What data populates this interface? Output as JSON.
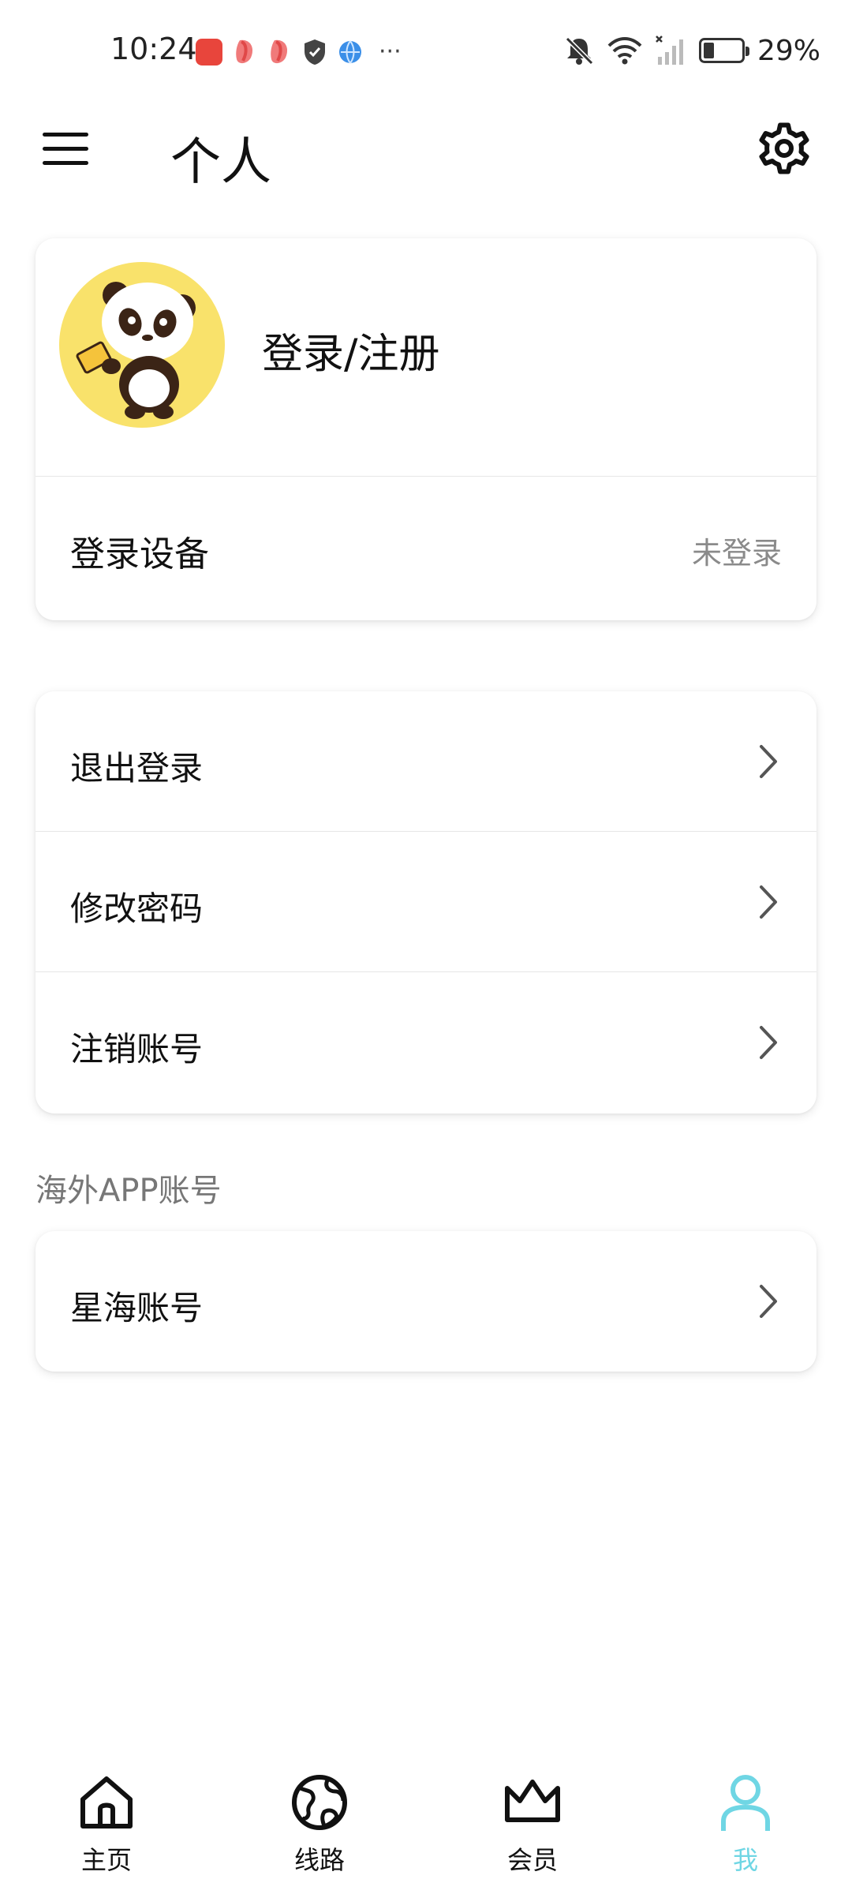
{
  "status_bar": {
    "time": "10:24",
    "battery_percent": "29%",
    "battery_level": 0.29
  },
  "header": {
    "title": "个人",
    "menu_icon": "menu-icon",
    "settings_icon": "gear-icon"
  },
  "profile": {
    "avatar_icon": "panda-avatar",
    "login_label": "登录/注册",
    "device_label": "登录设备",
    "device_status": "未登录"
  },
  "actions": [
    {
      "label": "退出登录"
    },
    {
      "label": "修改密码"
    },
    {
      "label": "注销账号"
    }
  ],
  "overseas": {
    "section_title": "海外APP账号",
    "items": [
      {
        "label": "星海账号"
      }
    ]
  },
  "bottom_nav": {
    "items": [
      {
        "label": "主页",
        "icon": "home-icon"
      },
      {
        "label": "线路",
        "icon": "globe-icon"
      },
      {
        "label": "会员",
        "icon": "crown-icon"
      },
      {
        "label": "我",
        "icon": "user-icon"
      }
    ],
    "active_index": 3
  },
  "colors": {
    "accent": "#6fd6e4",
    "avatar_bg": "#f9e26b",
    "secondary_text": "#8a8a8a"
  }
}
